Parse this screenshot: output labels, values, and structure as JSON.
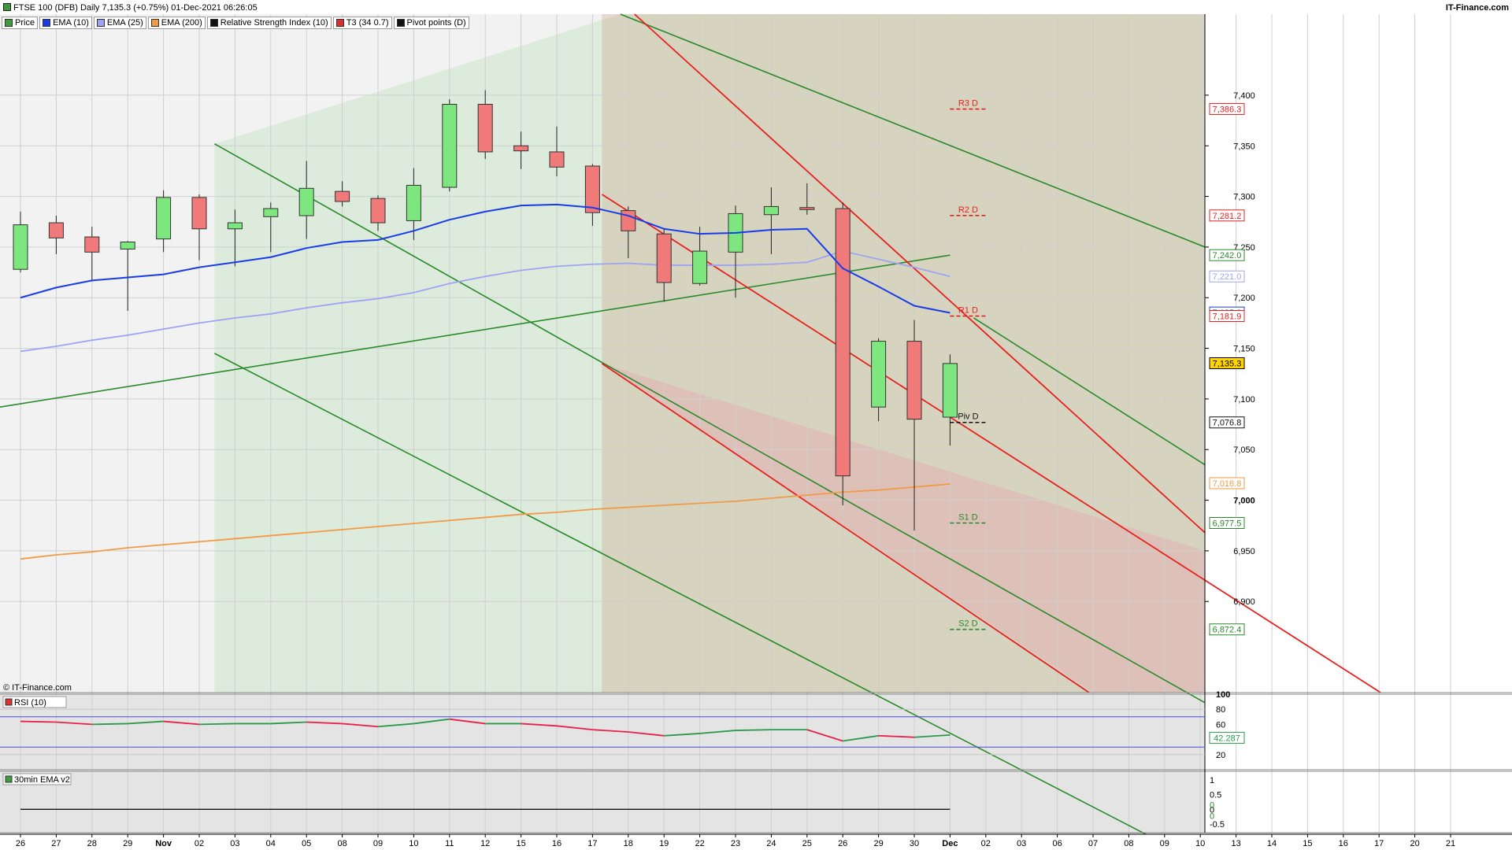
{
  "header": {
    "title": "FTSE 100 (DFB) Daily 7,135.3 (+0.75%) 01-Dec-2021 06:26:05",
    "brand": "IT-Finance.com",
    "copyright": "© IT-Finance.com"
  },
  "legend": [
    {
      "label": "Price",
      "color": "#3aa03a"
    },
    {
      "label": "EMA (10)",
      "color": "#1a3be8"
    },
    {
      "label": "EMA (25)",
      "color": "#9fa3f3"
    },
    {
      "label": "EMA (200)",
      "color": "#f29a45"
    },
    {
      "label": "Relative Strength Index (10)",
      "color": "#111111"
    },
    {
      "label": "T3 (34 0.7)",
      "color": "#d93030"
    },
    {
      "label": "Pivot points (D)",
      "color": "#111111"
    }
  ],
  "colors": {
    "up": "#7ee67e",
    "down": "#f07a7a",
    "ema10": "#1a3be8",
    "ema25": "#9fa3f3",
    "ema200": "#f29a45",
    "green_line": "#2a8a2a",
    "red_line": "#e82020",
    "rsi_up": "#2a9a4a",
    "rsi_down": "#e8204a"
  },
  "chart_data": [
    {
      "type": "candlestick",
      "title": "FTSE 100 (DFB) Daily",
      "ylim": [
        6810,
        7480
      ],
      "y_ticks": [
        7400,
        7350,
        7300,
        7250,
        7200,
        7150,
        7100,
        7050,
        7000,
        6950,
        6900
      ],
      "x_labels": [
        "26",
        "27",
        "28",
        "29",
        "Nov",
        "02",
        "03",
        "04",
        "05",
        "08",
        "09",
        "10",
        "11",
        "12",
        "15",
        "16",
        "17",
        "18",
        "19",
        "22",
        "23",
        "24",
        "25",
        "26",
        "29",
        "30",
        "Dec",
        "02",
        "03",
        "06",
        "07",
        "08",
        "09",
        "10",
        "13",
        "14",
        "15",
        "16",
        "17",
        "20",
        "21"
      ],
      "candles": [
        {
          "date": "26",
          "o": 7228,
          "h": 7285,
          "l": 7225,
          "c": 7272
        },
        {
          "date": "27",
          "o": 7274,
          "h": 7281,
          "l": 7243,
          "c": 7259
        },
        {
          "date": "28",
          "o": 7260,
          "h": 7270,
          "l": 7216,
          "c": 7245
        },
        {
          "date": "29",
          "o": 7248,
          "h": 7256,
          "l": 7187,
          "c": 7255
        },
        {
          "date": "Nov",
          "o": 7258,
          "h": 7306,
          "l": 7245,
          "c": 7299
        },
        {
          "date": "02",
          "o": 7299,
          "h": 7302,
          "l": 7237,
          "c": 7268
        },
        {
          "date": "03",
          "o": 7268,
          "h": 7287,
          "l": 7231,
          "c": 7274
        },
        {
          "date": "04",
          "o": 7280,
          "h": 7294,
          "l": 7245,
          "c": 7288
        },
        {
          "date": "05",
          "o": 7281,
          "h": 7335,
          "l": 7258,
          "c": 7308
        },
        {
          "date": "08",
          "o": 7305,
          "h": 7315,
          "l": 7290,
          "c": 7295
        },
        {
          "date": "09",
          "o": 7298,
          "h": 7301,
          "l": 7266,
          "c": 7274
        },
        {
          "date": "10",
          "o": 7276,
          "h": 7328,
          "l": 7257,
          "c": 7311
        },
        {
          "date": "11",
          "o": 7309,
          "h": 7396,
          "l": 7305,
          "c": 7391
        },
        {
          "date": "12",
          "o": 7391,
          "h": 7405,
          "l": 7337,
          "c": 7344
        },
        {
          "date": "15",
          "o": 7350,
          "h": 7364,
          "l": 7327,
          "c": 7345
        },
        {
          "date": "16",
          "o": 7344,
          "h": 7369,
          "l": 7320,
          "c": 7329
        },
        {
          "date": "17",
          "o": 7330,
          "h": 7332,
          "l": 7271,
          "c": 7284
        },
        {
          "date": "18",
          "o": 7286,
          "h": 7290,
          "l": 7239,
          "c": 7266
        },
        {
          "date": "19",
          "o": 7263,
          "h": 7268,
          "l": 7196,
          "c": 7215
        },
        {
          "date": "22",
          "o": 7214,
          "h": 7270,
          "l": 7212,
          "c": 7246
        },
        {
          "date": "23",
          "o": 7245,
          "h": 7291,
          "l": 7200,
          "c": 7283
        },
        {
          "date": "24",
          "o": 7282,
          "h": 7309,
          "l": 7243,
          "c": 7290
        },
        {
          "date": "25",
          "o": 7289,
          "h": 7313,
          "l": 7282,
          "c": 7287
        },
        {
          "date": "26",
          "o": 7288,
          "h": 7294,
          "l": 6995,
          "c": 7024
        },
        {
          "date": "29",
          "o": 7092,
          "h": 7160,
          "l": 7078,
          "c": 7157
        },
        {
          "date": "30",
          "o": 7157,
          "h": 7178,
          "l": 6970,
          "c": 7080
        },
        {
          "date": "Dec",
          "o": 7082,
          "h": 7144,
          "l": 7054,
          "c": 7135
        }
      ],
      "ema10": [
        7200,
        7210,
        7217,
        7220,
        7223,
        7230,
        7235,
        7240,
        7249,
        7255,
        7257,
        7266,
        7277,
        7285,
        7291,
        7292,
        7289,
        7281,
        7268,
        7263,
        7264,
        7267,
        7268,
        7229,
        7211,
        7192,
        7185
      ],
      "ema25": [
        7147,
        7152,
        7158,
        7163,
        7169,
        7175,
        7180,
        7184,
        7190,
        7195,
        7199,
        7205,
        7214,
        7221,
        7227,
        7231,
        7233,
        7234,
        7232,
        7232,
        7232,
        7233,
        7235,
        7246,
        7238,
        7230,
        7221
      ],
      "ema200": [
        6942,
        6946,
        6949,
        6953,
        6956,
        6959,
        6962,
        6965,
        6968,
        6971,
        6974,
        6977,
        6980,
        6983,
        6986,
        6988,
        6991,
        6993,
        6995,
        6997,
        6999,
        7002,
        7005,
        7008,
        7010,
        7013,
        7016
      ],
      "pivots": [
        {
          "label": "R3 D",
          "value": 7386.3,
          "color": "#e82020"
        },
        {
          "label": "R2 D",
          "value": 7281.2,
          "color": "#e82020"
        },
        {
          "label": "R1 D",
          "value": 7181.9,
          "color": "#e82020"
        },
        {
          "label": "Piv D",
          "value": 7076.8,
          "color": "#111111"
        },
        {
          "label": "S1 D",
          "value": 6977.5,
          "color": "#2a8a2a"
        },
        {
          "label": "S2 D",
          "value": 6872.4,
          "color": "#2a8a2a"
        }
      ],
      "price_labels": [
        {
          "text": "7,386.3",
          "value": 7386.3,
          "bg": "#ffffff",
          "fg": "#e82020"
        },
        {
          "text": "7,281.2",
          "value": 7281.2,
          "bg": "#ffffff",
          "fg": "#e82020"
        },
        {
          "text": "7,242.0",
          "value": 7242.0,
          "bg": "#ffffff",
          "fg": "#2a8a2a"
        },
        {
          "text": "7,221.0",
          "value": 7221.0,
          "bg": "#ffffff",
          "fg": "#9fa3f3"
        },
        {
          "text": "7,185.3",
          "value": 7185.3,
          "bg": "#ffffff",
          "fg": "#1a3be8"
        },
        {
          "text": "7,181.9",
          "value": 7181.9,
          "bg": "#ffffff",
          "fg": "#e82020"
        },
        {
          "text": "7,135.3",
          "value": 7135.3,
          "bg": "#ffd400",
          "fg": "#000000"
        },
        {
          "text": "7,076.8",
          "value": 7076.8,
          "bg": "#ffffff",
          "fg": "#111111"
        },
        {
          "text": "7,016.8",
          "value": 7016.8,
          "bg": "#ffffff",
          "fg": "#f29a45"
        },
        {
          "text": "6,977.5",
          "value": 6977.5,
          "bg": "#ffffff",
          "fg": "#2a8a2a"
        },
        {
          "text": "6,872.4",
          "value": 6872.4,
          "bg": "#ffffff",
          "fg": "#2a8a2a"
        }
      ]
    },
    {
      "type": "line",
      "title": "RSI (10)",
      "ylim": [
        0,
        100
      ],
      "y_ticks": [
        100,
        80,
        60,
        40,
        20
      ],
      "levels": [
        70,
        30
      ],
      "values": [
        64,
        63,
        60,
        61,
        64,
        60,
        61,
        61,
        63,
        61,
        57,
        61,
        67,
        61,
        61,
        58,
        53,
        50,
        45,
        48,
        52,
        53,
        53,
        38,
        45,
        43,
        46
      ],
      "last_label": "42.287"
    },
    {
      "type": "line",
      "title": "30min EMA v2",
      "ylim": [
        -0.8,
        1.3
      ],
      "y_ticks": [
        "1",
        "0.5",
        "0",
        "-0.5"
      ],
      "values": [
        0,
        0,
        0,
        0,
        0,
        0,
        0,
        0,
        0,
        0,
        0,
        0,
        0,
        0,
        0,
        0,
        0,
        0,
        0,
        0,
        0,
        0,
        0,
        0,
        0,
        0,
        0
      ],
      "last_labels": [
        "0",
        "0"
      ]
    }
  ]
}
